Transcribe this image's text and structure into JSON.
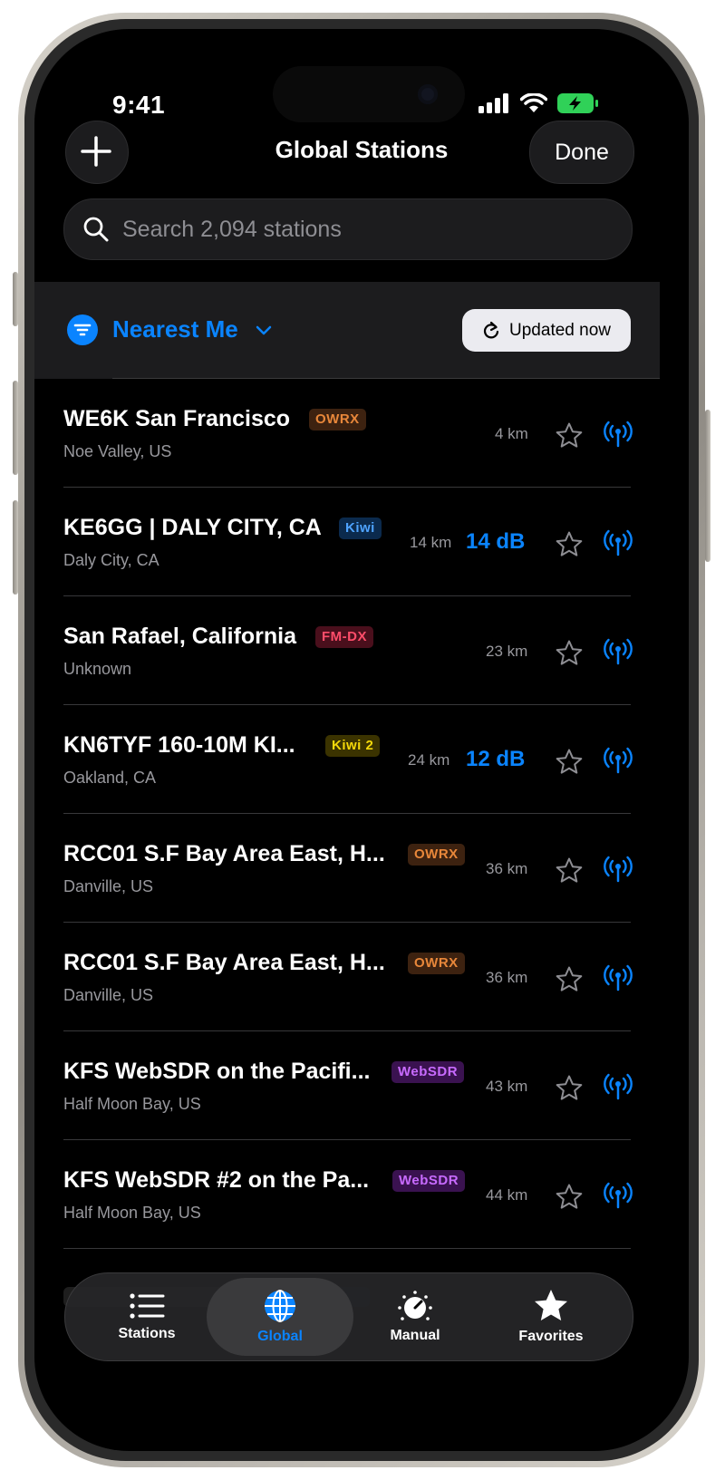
{
  "status_bar": {
    "time": "9:41"
  },
  "nav": {
    "title": "Global Stations",
    "done_label": "Done"
  },
  "search": {
    "placeholder": "Search 2,094 stations"
  },
  "filter": {
    "label": "Nearest Me",
    "updated_label": "Updated now"
  },
  "stations": [
    {
      "name": "WE6K San Francisco",
      "badge": "OWRX",
      "location": "Noe Valley, US",
      "distance": "4 km",
      "snr": ""
    },
    {
      "name": "KE6GG | DALY CITY, CA",
      "badge": "Kiwi",
      "location": "Daly City, CA",
      "distance": "14 km",
      "snr": "14  dB"
    },
    {
      "name": "San Rafael, California",
      "badge": "FM-DX",
      "location": "Unknown",
      "distance": "23 km",
      "snr": ""
    },
    {
      "name": "KN6TYF 160-10M KI...",
      "badge": "Kiwi 2",
      "location": "Oakland, CA",
      "distance": "24 km",
      "snr": "12  dB"
    },
    {
      "name": "RCC01 S.F Bay Area East, H...",
      "badge": "OWRX",
      "location": "Danville, US",
      "distance": "36 km",
      "snr": ""
    },
    {
      "name": "RCC01 S.F Bay Area East, H...",
      "badge": "OWRX",
      "location": "Danville, US",
      "distance": "36 km",
      "snr": ""
    },
    {
      "name": "KFS WebSDR on the Pacifi...",
      "badge": "WebSDR",
      "location": "Half Moon Bay, US",
      "distance": "43 km",
      "snr": ""
    },
    {
      "name": "KFS WebSDR #2 on the Pa...",
      "badge": "WebSDR",
      "location": "Half Moon Bay, US",
      "distance": "44 km",
      "snr": ""
    }
  ],
  "tabs": [
    {
      "label": "Stations",
      "icon": "list-icon"
    },
    {
      "label": "Global",
      "icon": "globe-icon",
      "selected": true
    },
    {
      "label": "Manual",
      "icon": "dial-icon"
    },
    {
      "label": "Favorites",
      "icon": "star-filled-icon"
    }
  ],
  "colors": {
    "accent": "#0a84ff",
    "background": "#000000",
    "owrx": "#e8873a",
    "kiwi": "#4ea3ff",
    "fmdx": "#ff4d6a",
    "kiwi2": "#f5d90a",
    "websdr": "#c86bff"
  }
}
